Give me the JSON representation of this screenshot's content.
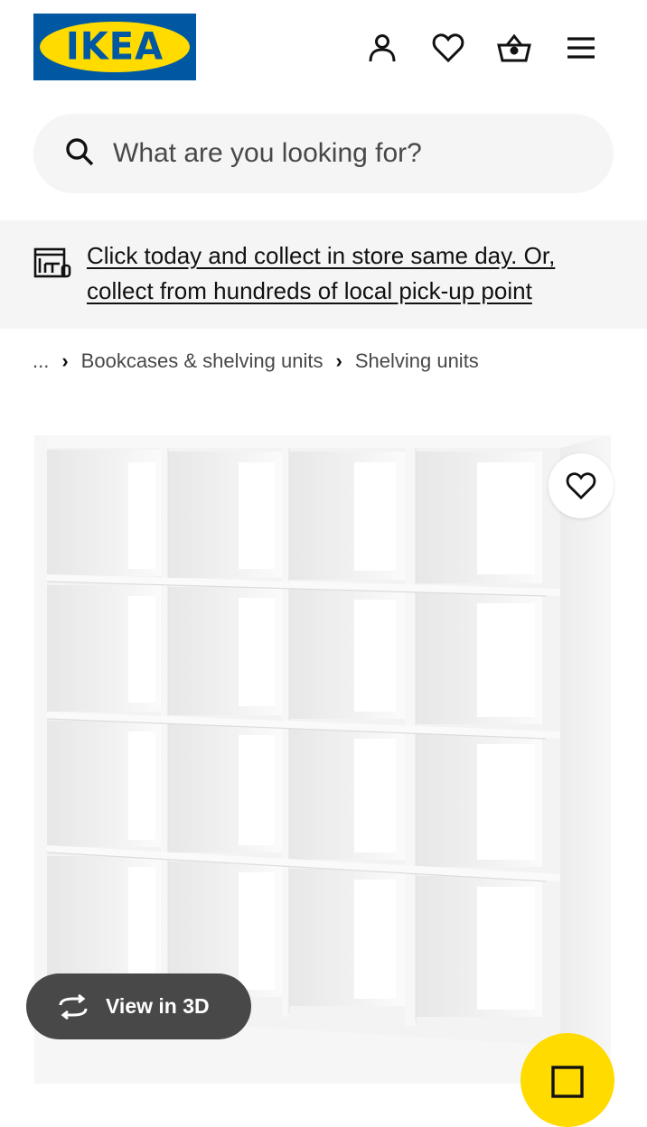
{
  "header": {
    "logo_text": "IKEA",
    "icons": [
      "account-icon",
      "heart-icon",
      "basket-icon",
      "menu-icon"
    ]
  },
  "search": {
    "placeholder": "What are you looking for?"
  },
  "banner": {
    "text": "Click today and collect in store same day. Or, collect from hundreds of local pick-up point"
  },
  "breadcrumb": {
    "items": [
      "...",
      "Bookcases & shelving units",
      "Shelving units"
    ]
  },
  "product": {
    "view_3d_label": "View in 3D"
  },
  "colors": {
    "brand_blue": "#0058a3",
    "brand_yellow": "#ffdb00",
    "pill_dark": "#484848",
    "surface_grey": "#f5f5f5"
  }
}
